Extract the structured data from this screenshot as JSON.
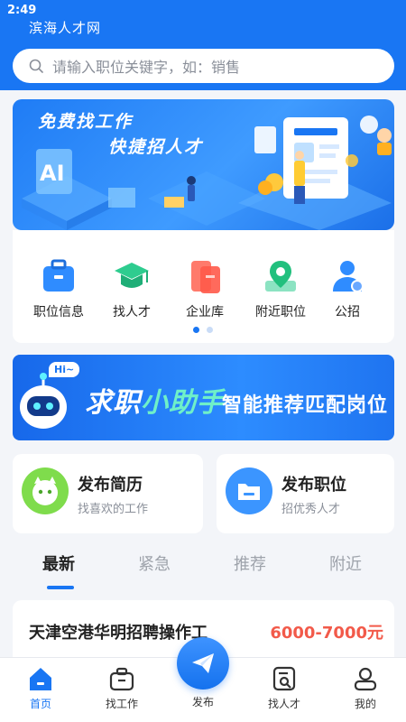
{
  "status": {
    "time": "2:49"
  },
  "app": {
    "title": "滨海人才网"
  },
  "search": {
    "placeholder": "请输入职位关键字，如：销售"
  },
  "banner": {
    "line1": "免费找工作",
    "line2": "快捷招人才"
  },
  "categories": [
    {
      "label": "职位信息",
      "icon": "briefcase-icon"
    },
    {
      "label": "找人才",
      "icon": "graduation-cap-icon"
    },
    {
      "label": "企业库",
      "icon": "company-folder-icon"
    },
    {
      "label": "附近职位",
      "icon": "map-pin-icon"
    },
    {
      "label": "公招",
      "icon": "person-badge-icon"
    }
  ],
  "assistant": {
    "hi": "Hi~",
    "title_part1": "求职",
    "title_part2": "小助手",
    "subtitle": "智能推荐匹配岗位"
  },
  "actions": [
    {
      "title": "发布简历",
      "subtitle": "找喜欢的工作",
      "icon": "resume-icon"
    },
    {
      "title": "发布职位",
      "subtitle": "招优秀人才",
      "icon": "folder-icon"
    }
  ],
  "tabs": [
    {
      "label": "最新",
      "active": true
    },
    {
      "label": "紧急",
      "active": false
    },
    {
      "label": "推荐",
      "active": false
    },
    {
      "label": "附近",
      "active": false
    }
  ],
  "job": {
    "title": "天津空港华明招聘操作工",
    "salary": "6000-7000元"
  },
  "nav": [
    {
      "label": "首页",
      "icon": "home-icon",
      "active": true
    },
    {
      "label": "找工作",
      "icon": "briefcase-icon",
      "active": false
    },
    {
      "label": "发布",
      "icon": "send-icon",
      "active": false
    },
    {
      "label": "找人才",
      "icon": "search-person-icon",
      "active": false
    },
    {
      "label": "我的",
      "icon": "profile-icon",
      "active": false
    }
  ],
  "colors": {
    "brand": "#1976f3",
    "salary": "#f25a4a",
    "accent_green": "#6ff0c8"
  }
}
